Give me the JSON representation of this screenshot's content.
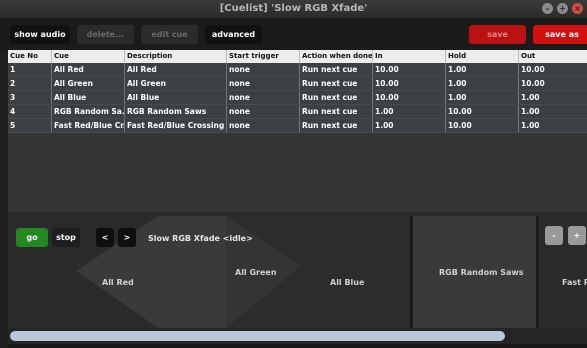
{
  "window": {
    "title": "[Cuelist] 'Slow RGB Xfade'"
  },
  "toolbar": {
    "show_audio_track": "show audio track",
    "delete": "delete...",
    "edit_cue": "edit cue",
    "advanced_timings": "advanced timings",
    "save": "save",
    "save_as": "save as cuelist..."
  },
  "table": {
    "headers": [
      "Cue No",
      "Cue",
      "Description",
      "Start trigger",
      "Action when done",
      "In",
      "Hold",
      "Out"
    ],
    "rows": [
      [
        "1",
        "All Red",
        "All Red",
        "none",
        "Run next cue",
        "10.00",
        "1.00",
        "10.00"
      ],
      [
        "2",
        "All Green",
        "All Green",
        "none",
        "Run next cue",
        "10.00",
        "1.00",
        "10.00"
      ],
      [
        "3",
        "All Blue",
        "All Blue",
        "none",
        "Run next cue",
        "10.00",
        "1.00",
        "1.00"
      ],
      [
        "4",
        "RGB Random Sa...",
        "RGB Random Saws",
        "none",
        "Run next cue",
        "1.00",
        "10.00",
        "1.00"
      ],
      [
        "5",
        "Fast Red/Blue Cr...",
        "Fast Red/Blue Crossing",
        "none",
        "Run next cue",
        "1.00",
        "10.00",
        "1.00"
      ]
    ]
  },
  "playback": {
    "go": "go",
    "stop": "stop",
    "prev": "<",
    "next": ">",
    "status": "Slow RGB Xfade <idle>",
    "zoom_out": "-",
    "zoom_in": "+"
  },
  "timeline": {
    "cues": [
      "All Red",
      "All Green",
      "All Blue",
      "RGB Random Saws",
      "Fast Re"
    ]
  },
  "colors": {
    "go_green": "#21891f",
    "save_red": "#d00f0f",
    "highlight_blue": "#b9c6d8"
  }
}
